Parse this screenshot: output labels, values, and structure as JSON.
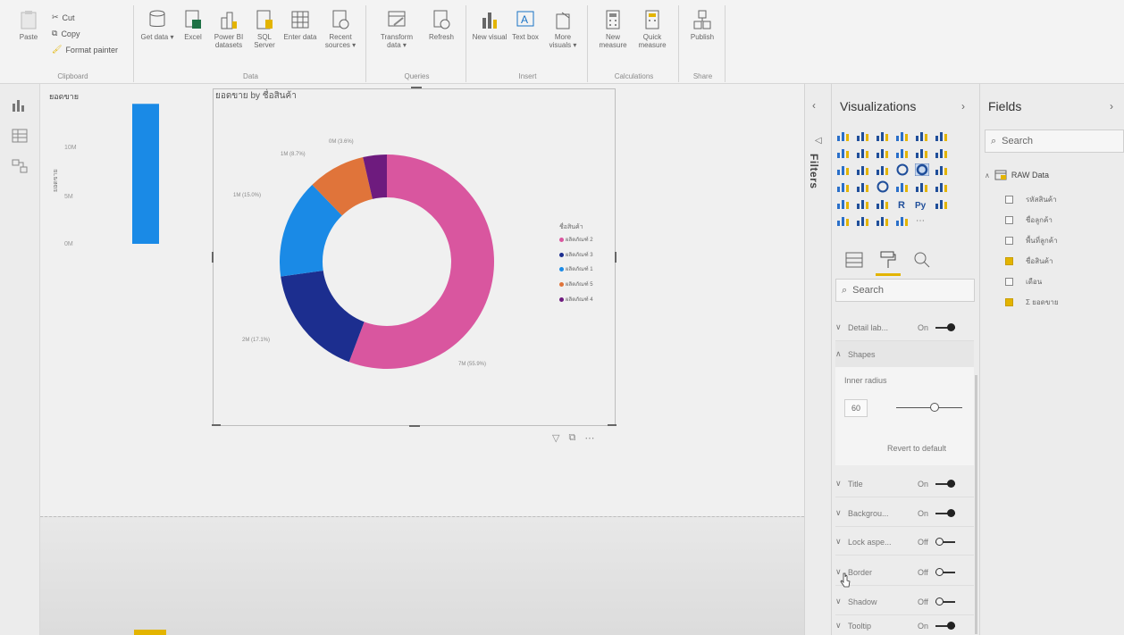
{
  "ribbon": {
    "clipboard": {
      "label": "Clipboard",
      "paste": "Paste",
      "cut": "Cut",
      "copy": "Copy",
      "format_painter": "Format painter"
    },
    "data": {
      "label": "Data",
      "buttons": [
        {
          "label": "Get data ▾",
          "icon": "get-data-icon"
        },
        {
          "label": "Excel",
          "icon": "excel-icon"
        },
        {
          "label": "Power BI datasets",
          "icon": "power-bi-datasets-icon"
        },
        {
          "label": "SQL Server",
          "icon": "sql-server-icon"
        },
        {
          "label": "Enter data",
          "icon": "enter-data-icon"
        },
        {
          "label": "Recent sources ▾",
          "icon": "recent-sources-icon"
        }
      ]
    },
    "queries": {
      "label": "Queries",
      "buttons": [
        {
          "label": "Transform data ▾",
          "icon": "transform-data-icon"
        },
        {
          "label": "Refresh",
          "icon": "refresh-icon"
        }
      ]
    },
    "insert": {
      "label": "Insert",
      "buttons": [
        {
          "label": "New visual",
          "icon": "new-visual-icon"
        },
        {
          "label": "Text box",
          "icon": "text-box-icon"
        },
        {
          "label": "More visuals ▾",
          "icon": "more-visuals-icon"
        }
      ]
    },
    "calculations": {
      "label": "Calculations",
      "buttons": [
        {
          "label": "New measure",
          "icon": "new-measure-icon"
        },
        {
          "label": "Quick measure",
          "icon": "quick-measure-icon"
        }
      ]
    },
    "share": {
      "label": "Share",
      "buttons": [
        {
          "label": "Publish",
          "icon": "publish-icon"
        }
      ]
    }
  },
  "canvas": {
    "column_visual": {
      "title": "ยอดขาย",
      "y_ticks": [
        "10M",
        "5M",
        "0M"
      ],
      "y_label": "ยอดขาย"
    },
    "donut_visual": {
      "title": "ยอดขาย by ชื่อสินค้า",
      "legend_title": "ชื่อสินค้า",
      "legend": [
        "ผลิตภัณฑ์ 2",
        "ผลิตภัณฑ์ 3",
        "ผลิตภัณฑ์ 1",
        "ผลิตภัณฑ์ 5",
        "ผลิตภัณฑ์ 4"
      ],
      "data_labels": {
        "s1": "7M (55.9%)",
        "s2": "2M (17.1%)",
        "s3": "1M (15.0%)",
        "s4": "1M (8.7%)",
        "s5": "0M (3.6%)"
      },
      "actions": [
        "filter-icon",
        "focus-mode-icon",
        "more-options-icon"
      ]
    }
  },
  "chart_data": {
    "type": "pie",
    "title": "ยอดขาย by ชื่อสินค้า",
    "categories": [
      "ผลิตภัณฑ์ 2",
      "ผลิตภัณฑ์ 3",
      "ผลิตภัณฑ์ 1",
      "ผลิตภัณฑ์ 5",
      "ผลิตภัณฑ์ 4"
    ],
    "values": [
      55.9,
      17.1,
      15.0,
      8.7,
      3.6
    ],
    "colors": [
      "#d9569f",
      "#1c2e8f",
      "#1a8ae6",
      "#e0743a",
      "#6e1b7e"
    ],
    "inner_radius_percent": 60,
    "legend_position": "right"
  },
  "column_chart": {
    "type": "bar",
    "title": "ยอดขาย",
    "values": [
      12.5
    ],
    "ylim": [
      0,
      13
    ],
    "color": "#1a8ae6"
  },
  "filters": {
    "label": "Filters"
  },
  "visualizations": {
    "title": "Visualizations",
    "search_placeholder": "Search",
    "format_rows": [
      {
        "name": "Detail lab...",
        "state": "On",
        "on": true
      },
      {
        "name": "Shapes",
        "state": "",
        "on": null
      },
      {
        "name": "Title",
        "state": "On",
        "on": true
      },
      {
        "name": "Backgrou...",
        "state": "On",
        "on": true
      },
      {
        "name": "Lock aspe...",
        "state": "Off",
        "on": false
      },
      {
        "name": "Border",
        "state": "Off",
        "on": false
      },
      {
        "name": "Shadow",
        "state": "Off",
        "on": false
      },
      {
        "name": "Tooltip",
        "state": "On",
        "on": true
      }
    ],
    "inner_radius_label": "Inner radius",
    "inner_radius_value": "60",
    "revert_label": "Revert to default"
  },
  "fields": {
    "title": "Fields",
    "search_placeholder": "Search",
    "table_name": "RAW Data",
    "items": [
      {
        "label": "รหัสสินค้า",
        "checked": false
      },
      {
        "label": "ชื่อลูกค้า",
        "checked": false
      },
      {
        "label": "พื้นที่ลูกค้า",
        "checked": false
      },
      {
        "label": "ชื่อสินค้า",
        "checked": true
      },
      {
        "label": "เดือน",
        "checked": false
      },
      {
        "label": "Σ ยอดขาย",
        "checked": true
      }
    ]
  },
  "colors": {
    "accent": "#e3b400",
    "column_blue": "#1a8ae6"
  }
}
